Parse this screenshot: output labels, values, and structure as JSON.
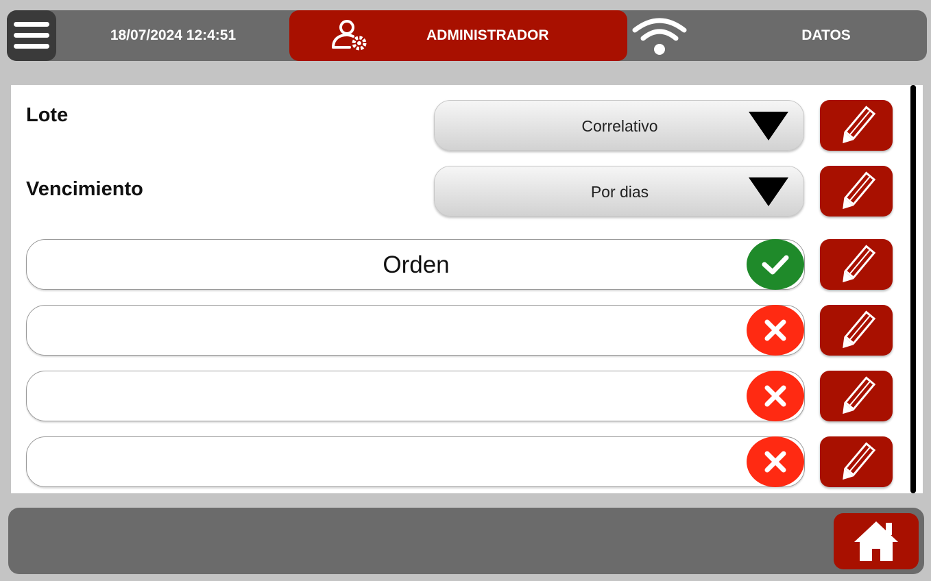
{
  "header": {
    "datetime": "18/07/2024 12:4:51",
    "user_role": "ADMINISTRADOR",
    "datos_label": "DATOS",
    "menu_icon": "hamburger-menu-icon",
    "user_icon": "user-settings-icon",
    "wifi_icon": "wifi-icon"
  },
  "settings": {
    "lote": {
      "label": "Lote",
      "value": "Correlativo"
    },
    "vencimiento": {
      "label": "Vencimiento",
      "value": "Por dias"
    },
    "fields": [
      {
        "value": "Orden",
        "status": "enabled"
      },
      {
        "value": "",
        "status": "disabled"
      },
      {
        "value": "",
        "status": "disabled"
      },
      {
        "value": "",
        "status": "disabled"
      }
    ]
  },
  "footer": {
    "home_icon": "home-icon"
  },
  "colors": {
    "accent_red": "#a81000",
    "enabled_green": "#1f8a2a",
    "disabled_red": "#ff2a12",
    "bar_gray": "#6b6b6b"
  }
}
